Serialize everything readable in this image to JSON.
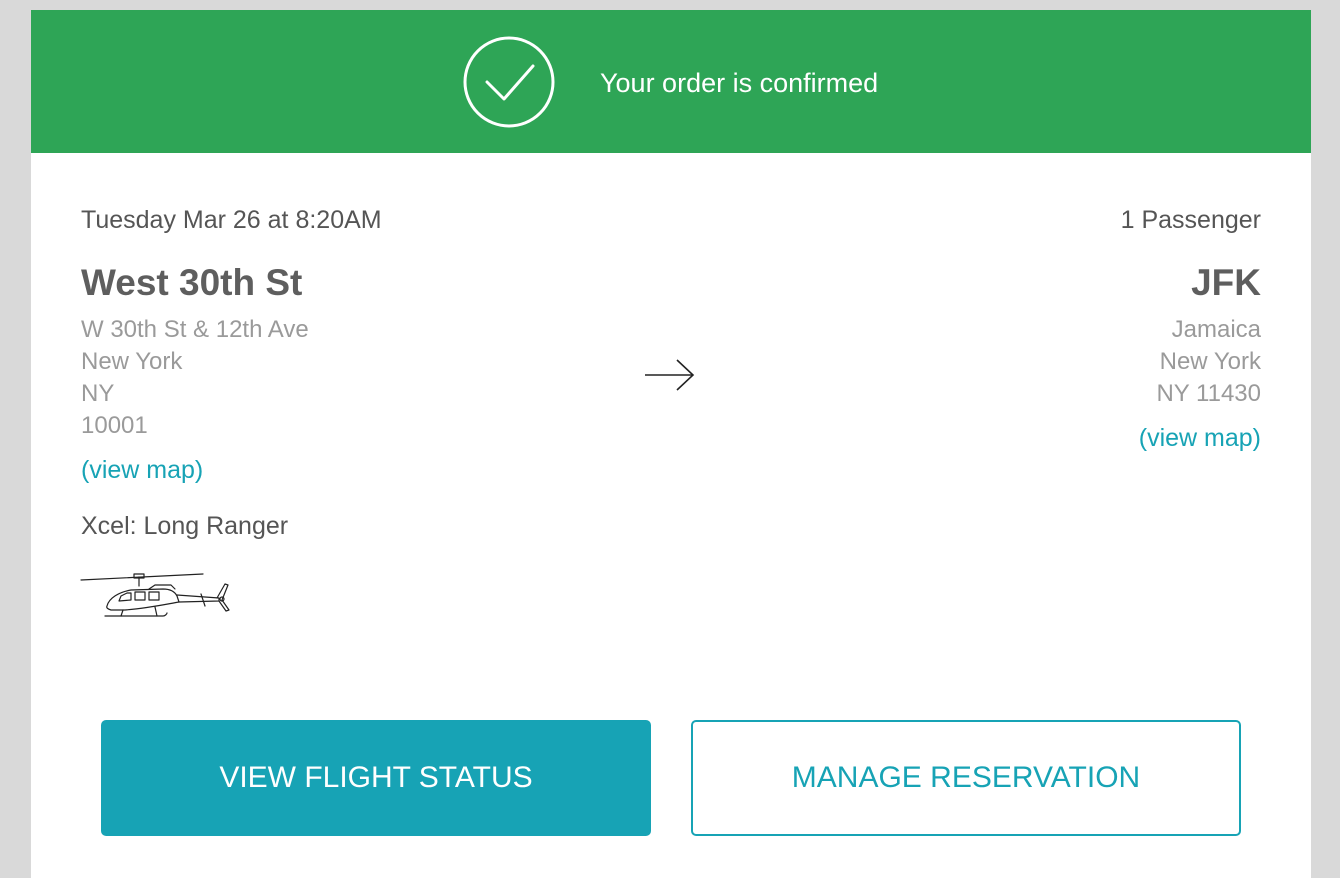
{
  "banner": {
    "message": "Your order is confirmed",
    "icon": "check-circle-icon",
    "color": "#2ea556"
  },
  "trip": {
    "datetime": "Tuesday Mar 26 at 8:20AM",
    "passengers": "1 Passenger",
    "aircraft": "Xcel: Long Ranger",
    "aircraft_icon": "helicopter-icon",
    "direction_icon": "right-arrow-icon"
  },
  "origin": {
    "name": "West 30th St",
    "address": [
      "W 30th St & 12th Ave",
      "New York",
      "NY",
      "10001"
    ],
    "map_link": "(view map)"
  },
  "destination": {
    "name": "JFK",
    "address": [
      "Jamaica",
      "New York",
      "NY 11430"
    ],
    "map_link": "(view map)"
  },
  "actions": {
    "primary": "VIEW FLIGHT STATUS",
    "secondary": "MANAGE RESERVATION",
    "accent": "#17a3b5"
  }
}
